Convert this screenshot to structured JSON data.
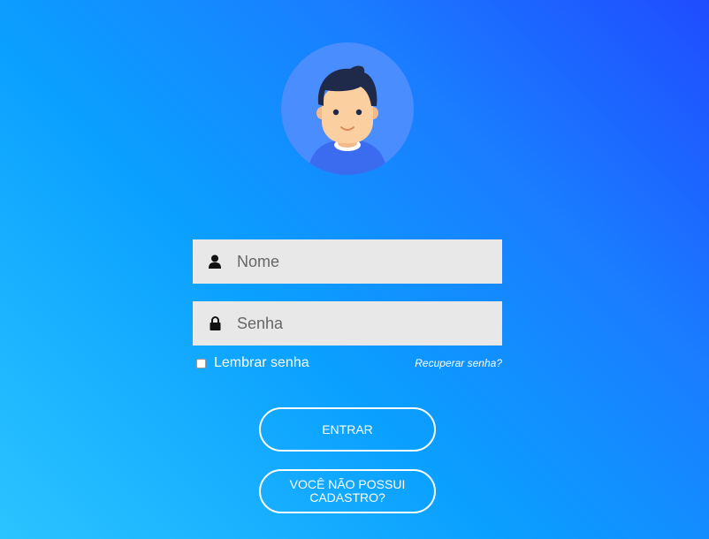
{
  "avatar": {
    "icon": "user-avatar-icon",
    "bg_color": "#4a8dff"
  },
  "form": {
    "name_placeholder": "Nome",
    "name_icon": "user-icon",
    "password_placeholder": "Senha",
    "password_icon": "lock-icon",
    "remember_label": "Lembrar senha",
    "remember_checked": false,
    "recover_link": "Recuperar senha?"
  },
  "buttons": {
    "login_label": "ENTRAR",
    "register_label": "VOCÊ NÃO POSSUI CADASTRO?"
  },
  "colors": {
    "gradient_top_right": "#1f4cff",
    "gradient_bottom_left": "#2bc4ff",
    "field_bg": "#e8e8e8"
  }
}
